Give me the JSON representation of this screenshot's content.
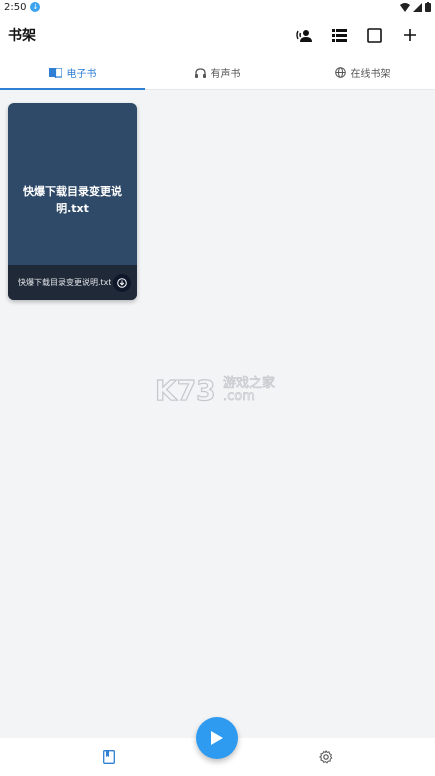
{
  "status_bar": {
    "time": "2:50"
  },
  "app_bar": {
    "title": "书架",
    "actions": [
      "voice-user-icon",
      "list-view-icon",
      "select-square-icon",
      "add-icon"
    ]
  },
  "tabs": [
    {
      "label": "电子书",
      "icon": "book-open-icon",
      "active": true
    },
    {
      "label": "有声书",
      "icon": "headphones-icon",
      "active": false
    },
    {
      "label": "在线书架",
      "icon": "globe-icon",
      "active": false
    }
  ],
  "books": [
    {
      "cover_title": "快爆下载目录变更说明.txt",
      "name": "快爆下载目录变更说明.txt"
    }
  ],
  "watermark": {
    "brand": "K73",
    "text": "游戏之家",
    "domain": ".com"
  },
  "bottom_nav": [
    {
      "name": "bookshelf",
      "icon": "book-icon",
      "active": true
    },
    {
      "name": "settings",
      "icon": "gear-icon",
      "active": false
    }
  ],
  "colors": {
    "accent": "#2f7fd4",
    "fab": "#2f9bf0",
    "cover": "#2f4a68"
  }
}
